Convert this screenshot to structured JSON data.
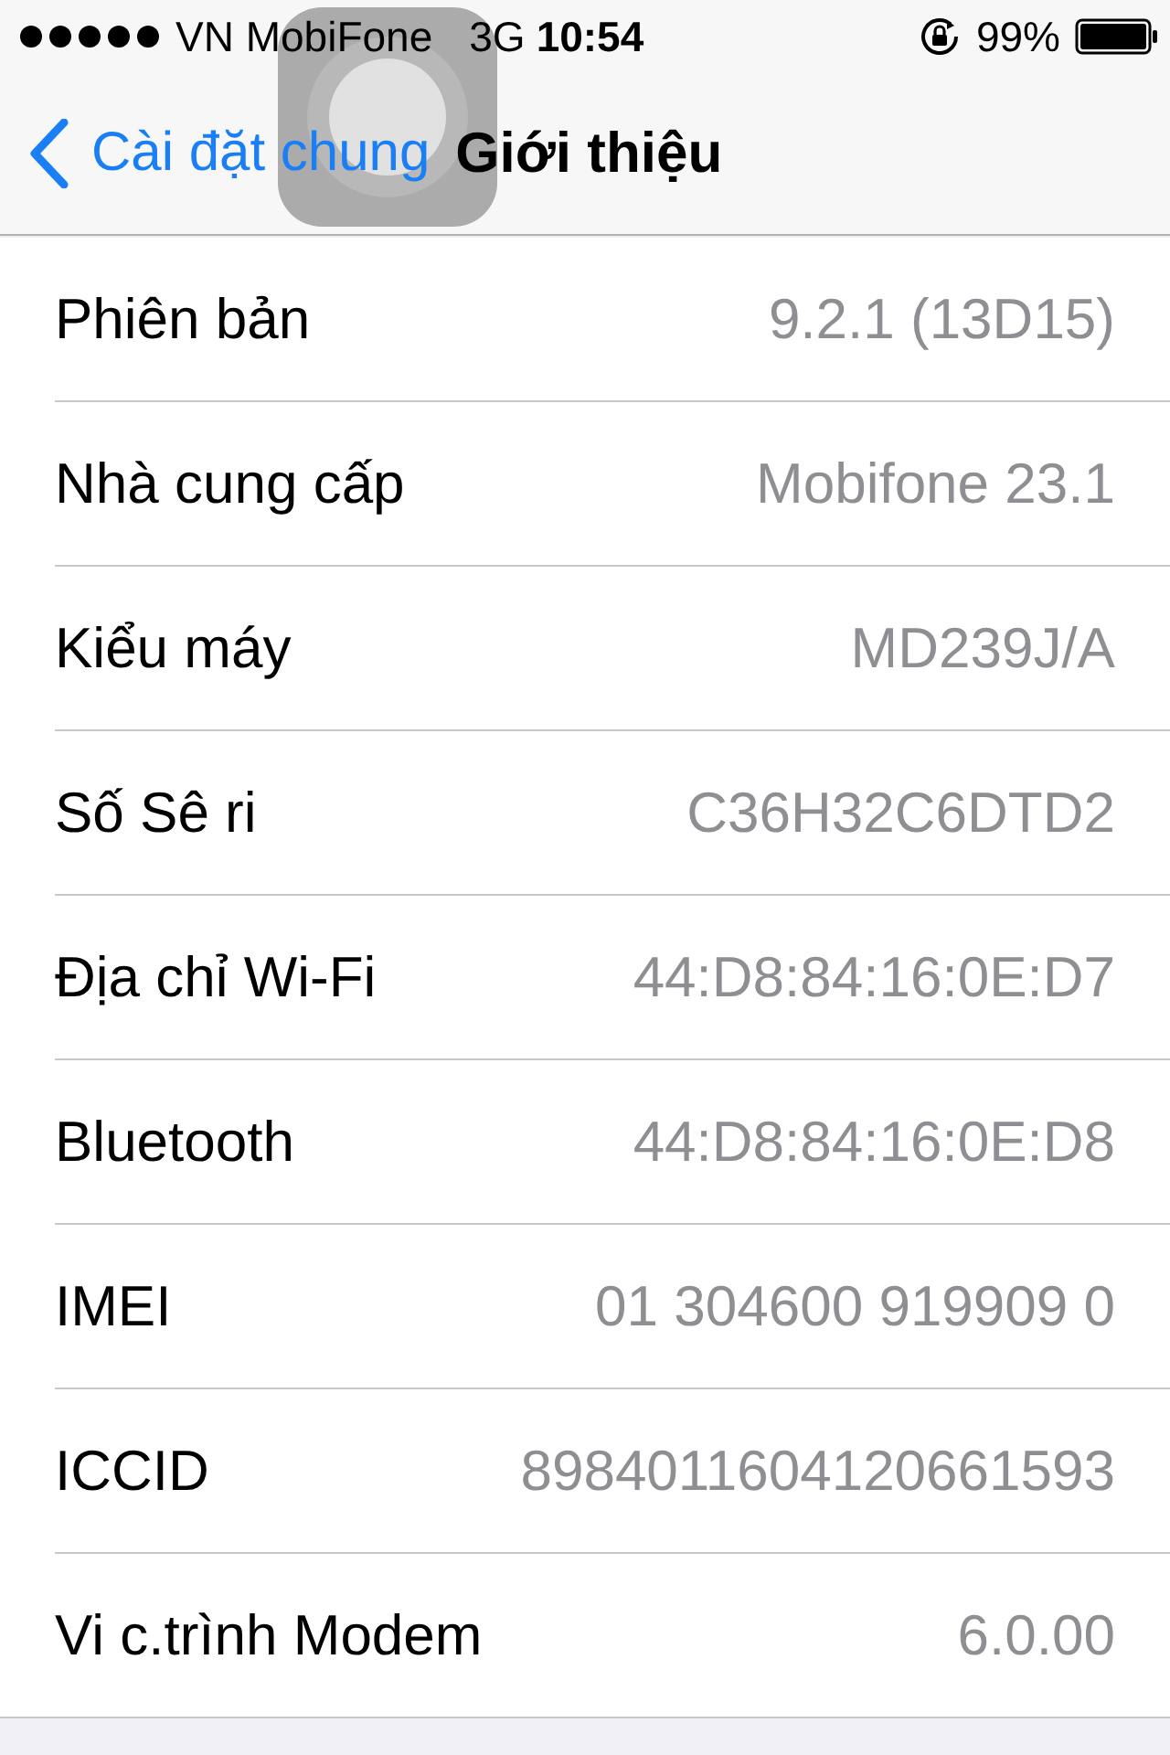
{
  "status_bar": {
    "carrier": "VN MobiFone",
    "network": "3G",
    "time": "10:54",
    "battery": "99%"
  },
  "nav": {
    "back": "Cài đặt chung",
    "title": "Giới thiệu"
  },
  "rows": [
    {
      "label": "Phiên bản",
      "value": "9.2.1 (13D15)"
    },
    {
      "label": "Nhà cung cấp",
      "value": "Mobifone 23.1"
    },
    {
      "label": "Kiểu máy",
      "value": "MD239J/A"
    },
    {
      "label": "Số Sê ri",
      "value": "C36H32C6DTD2"
    },
    {
      "label": "Địa chỉ Wi-Fi",
      "value": "44:D8:84:16:0E:D7"
    },
    {
      "label": "Bluetooth",
      "value": "44:D8:84:16:0E:D8"
    },
    {
      "label": "IMEI",
      "value": "01 304600 919909 0"
    },
    {
      "label": "ICCID",
      "value": "8984011604120661593"
    },
    {
      "label": "Vi c.trình Modem",
      "value": "6.0.00"
    }
  ]
}
